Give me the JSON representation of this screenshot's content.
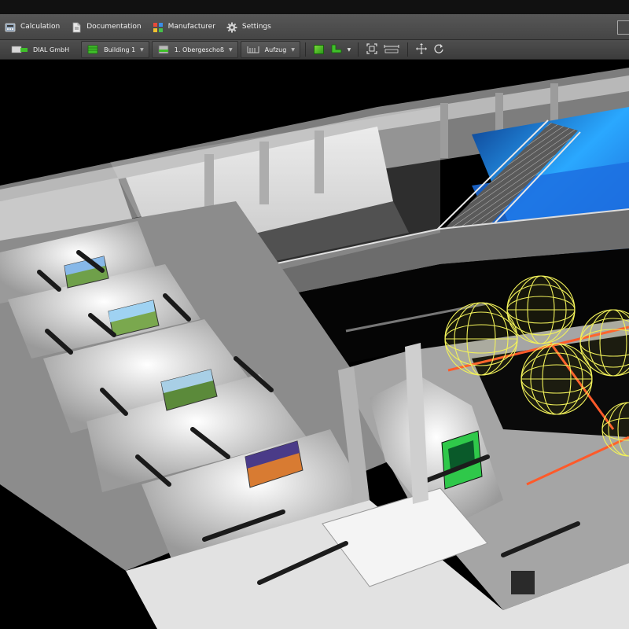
{
  "menu": {
    "calculation": "Calculation",
    "documentation": "Documentation",
    "manufacturer": "Manufacturer",
    "settings": "Settings"
  },
  "toolbar": {
    "project": "DIAL GmbH",
    "building": "Building 1",
    "floor": "1. Obergeschoß",
    "room": "Aufzug"
  },
  "icons": {
    "calculation": "calculator-icon",
    "documentation": "document-icon",
    "manufacturer": "catalog-icon",
    "settings": "gear-icon",
    "pan": "move-icon",
    "rotate": "rotate-icon",
    "fit": "zoom-fit-icon",
    "measure": "measure-icon"
  },
  "colors": {
    "accent_green": "#3fbf2a",
    "luminaire_yellow": "#f2f25a",
    "glow_blue": "#2aa8ff"
  }
}
